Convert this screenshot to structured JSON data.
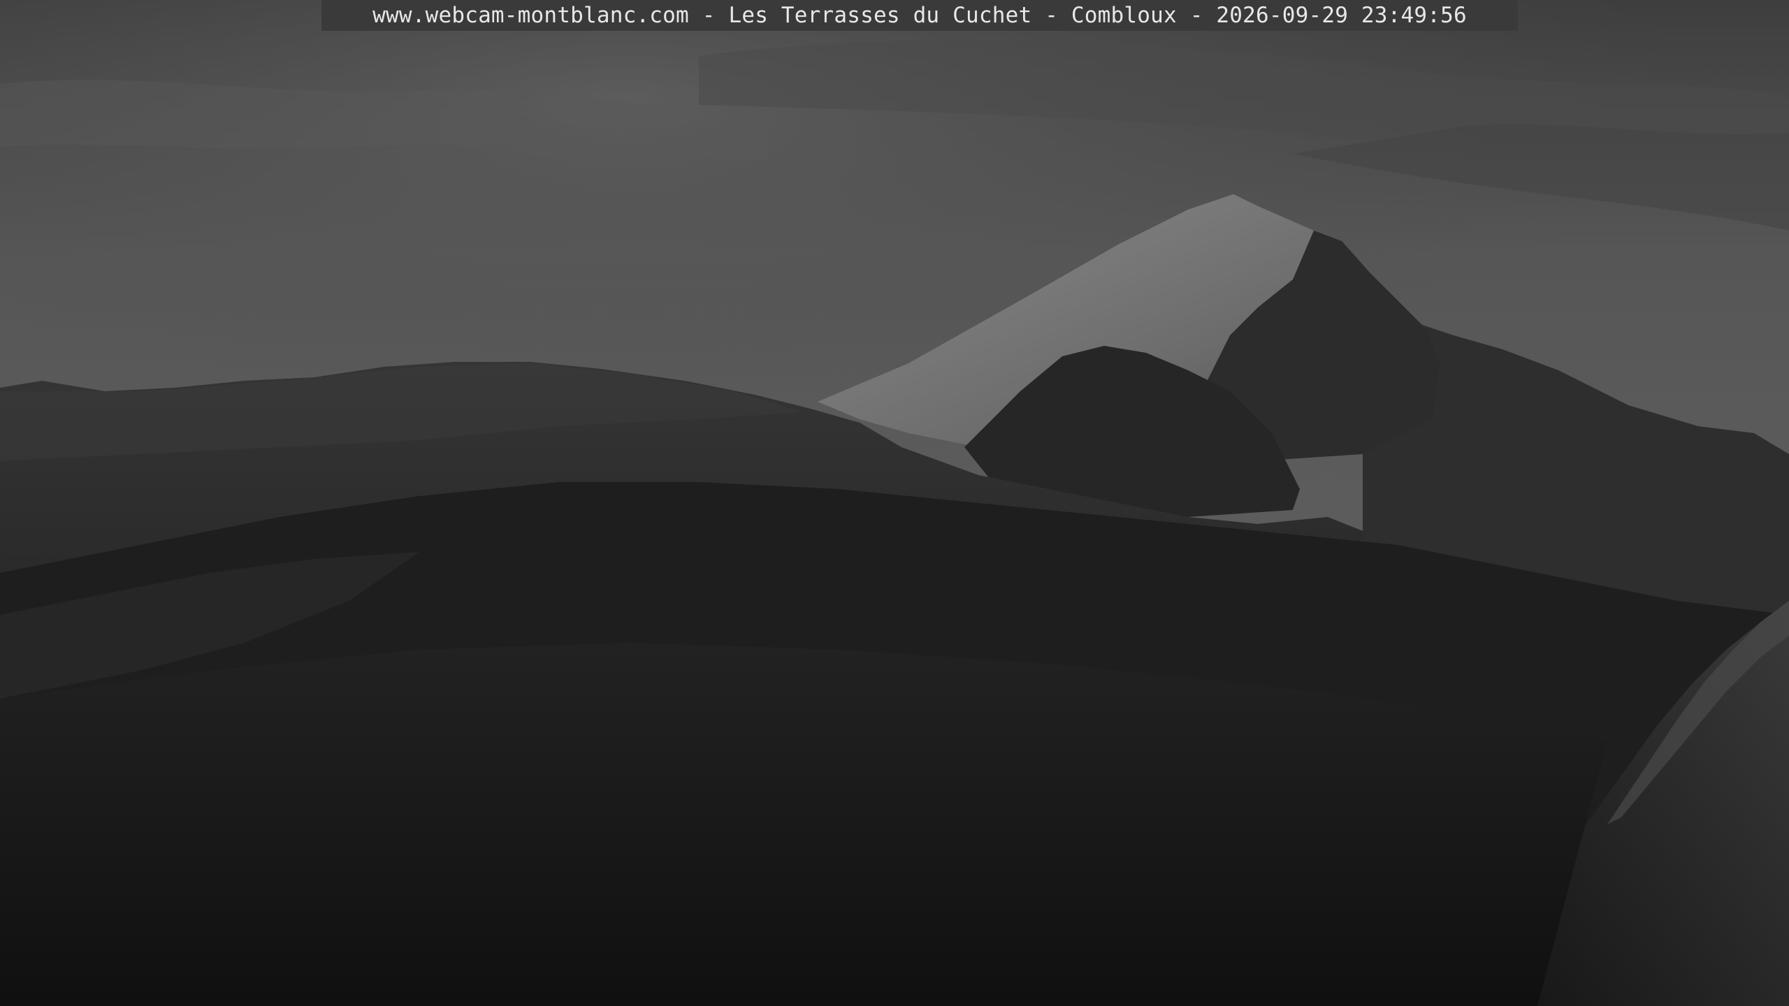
{
  "overlay": {
    "caption": "www.webcam-montblanc.com - Les Terrasses du Cuchet - Combloux - 2026-09-29 23:49:56"
  },
  "scene": {
    "colors": {
      "sky_top": "#4a4a4a",
      "sky_mid": "#5e5e5e",
      "sky_low": "#565656",
      "peak_snow": "#7a7a7a",
      "ridge_dark": "#2b2b2b",
      "hill_mid": "#262626",
      "foreground": "#151515"
    }
  }
}
